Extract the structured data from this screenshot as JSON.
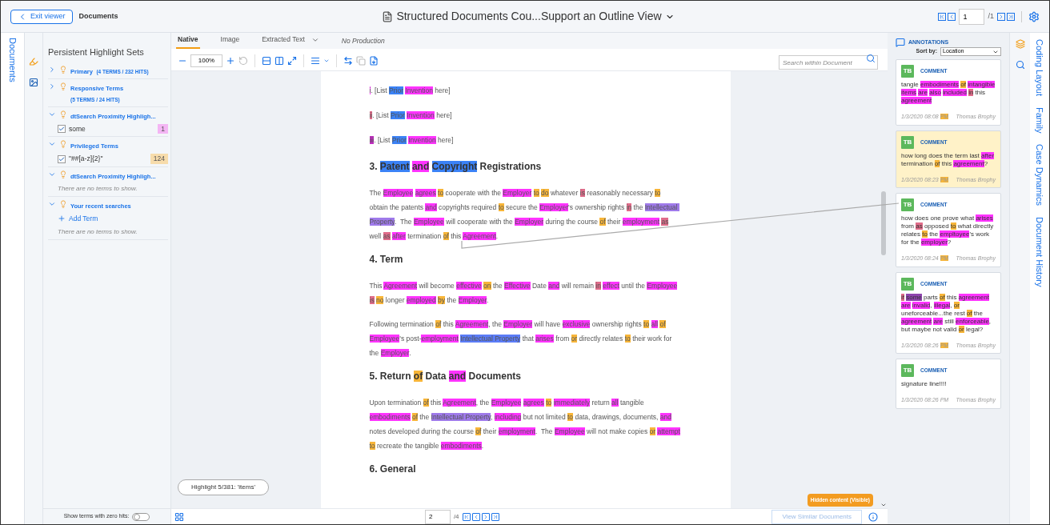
{
  "topbar": {
    "exit_button": "Exit viewer",
    "breadcrumb": "Documents",
    "title": "Structured Documents Cou...Support an Outline View",
    "page": "1",
    "page_total": "/1"
  },
  "left_rail": {
    "tab": "Documents"
  },
  "highlights": {
    "title": "Persistent Highlight Sets",
    "sets": [
      {
        "name": "Primary",
        "summary": "(4 TERMS / 232 HITS)",
        "expanded": false
      },
      {
        "name": "Responsive Terms",
        "summary": "(5 TERMS / 24 HITS)",
        "expanded": false
      },
      {
        "name": "dtSearch Proximity Highligh...",
        "expanded": true,
        "terms": [
          {
            "label": "some",
            "checked": true,
            "count": "1",
            "color": "#f4b6f4"
          }
        ]
      },
      {
        "name": "Privileged Terms",
        "expanded": true,
        "terms": [
          {
            "label": "\"##[a-z]{2}\"",
            "checked": true,
            "count": "124",
            "color": "#f7dcab"
          }
        ]
      },
      {
        "name": "dtSearch Proximity Highligh...",
        "expanded": true,
        "empty": "There are no terms to show."
      },
      {
        "name": "Your recent searches",
        "expanded": true,
        "add_term": "Add Term",
        "empty": "There are no terms to show."
      }
    ],
    "zero_hits_label": "Show terms with zero hits:",
    "zero_hits_on": false,
    "highlight_status": "Highlight 5/381: 'items'"
  },
  "viewer": {
    "tabs": [
      {
        "label": "Native",
        "kind": "tab",
        "selected": true
      },
      {
        "label": "Image",
        "kind": "tab",
        "selected": false
      },
      {
        "label": "Extracted Text",
        "kind": "dropdown",
        "selected": false
      }
    ],
    "production_status": "No Production",
    "zoom": "100%",
    "search_placeholder": "Search within Document",
    "document": [
      {
        "kind": "list_item",
        "segments": [
          {
            "text": "i",
            "color": "#ff33ff"
          },
          {
            "text": ". [List "
          },
          {
            "text": "Prior",
            "color": "#3b82f6"
          },
          {
            "text": " Invention",
            "color": "#ff33ff"
          },
          {
            "text": " here]"
          }
        ]
      },
      {
        "kind": "list_item",
        "segments": [
          {
            "text": "ii",
            "color": "#e06c8a"
          },
          {
            "text": ". [List "
          },
          {
            "text": "Prior",
            "color": "#3b82f6"
          },
          {
            "text": " Invention",
            "color": "#ff33ff"
          },
          {
            "text": " here]"
          }
        ]
      },
      {
        "kind": "list_item",
        "segments": [
          {
            "text": "iii",
            "color": "#c22cc2"
          },
          {
            "text": ". [List "
          },
          {
            "text": "Prior",
            "color": "#3b82f6"
          },
          {
            "text": " Invention",
            "color": "#ff33ff"
          },
          {
            "text": " here]"
          }
        ]
      },
      {
        "kind": "heading",
        "segments": [
          {
            "text": "3.  "
          },
          {
            "text": "Patent",
            "color": "#3b82f6"
          },
          {
            "text": " and",
            "color": "#ff33ff"
          },
          {
            "text": " Copyright",
            "color": "#3b82f6"
          },
          {
            "text": " Registrations"
          }
        ]
      },
      {
        "kind": "paragraph",
        "segments": [
          {
            "text": "The "
          },
          {
            "text": "Employee",
            "color": "#ff33ff"
          },
          {
            "text": " agrees",
            "color": "#ff33ff"
          },
          {
            "text": " to",
            "color": "#f7b538"
          },
          {
            "text": " cooperate with the "
          },
          {
            "text": "Employer",
            "color": "#ff33ff"
          },
          {
            "text": " to",
            "color": "#f7b538"
          },
          {
            "text": " do",
            "color": "#f7b538"
          },
          {
            "text": " whatever "
          },
          {
            "text": "is",
            "color": "#e06c8a"
          },
          {
            "text": " reasonably necessary "
          },
          {
            "text": "to",
            "color": "#f7b538"
          },
          {
            "text": " obtain the patents "
          },
          {
            "text": "and",
            "color": "#ff33ff"
          },
          {
            "text": " copyrights required "
          },
          {
            "text": "to",
            "color": "#f7b538"
          },
          {
            "text": " secure the "
          },
          {
            "text": "Employer",
            "color": "#ff33ff"
          },
          {
            "text": "'s ownership rights "
          },
          {
            "text": "in",
            "color": "#e06c8a"
          },
          {
            "text": " the "
          },
          {
            "text": "Intellectual Property",
            "color": "#9f7aea"
          },
          {
            "text": ".  The "
          },
          {
            "text": "Employee",
            "color": "#ff33ff"
          },
          {
            "text": " will cooperate with the "
          },
          {
            "text": "Employer",
            "color": "#ff33ff"
          },
          {
            "text": " during the course "
          },
          {
            "text": "of",
            "color": "#f7b538"
          },
          {
            "text": " their "
          },
          {
            "text": "employment",
            "color": "#ff33ff"
          },
          {
            "text": " as",
            "color": "#e06c8a"
          },
          {
            "text": " well "
          },
          {
            "text": "as",
            "color": "#e06c8a"
          },
          {
            "text": " after",
            "color": "#ff33ff"
          },
          {
            "text": " termination "
          },
          {
            "text": "of",
            "color": "#f7b538"
          },
          {
            "text": " this "
          },
          {
            "text": "Agreement",
            "color": "#ff33ff"
          },
          {
            "text": "."
          }
        ]
      },
      {
        "kind": "heading",
        "segments": [
          {
            "text": "4.  Term"
          }
        ]
      },
      {
        "kind": "paragraph",
        "segments": [
          {
            "text": "This "
          },
          {
            "text": "Agreement",
            "color": "#ff33ff"
          },
          {
            "text": " will become "
          },
          {
            "text": "effective",
            "color": "#ff33ff"
          },
          {
            "text": " on",
            "color": "#f7b538"
          },
          {
            "text": " the "
          },
          {
            "text": "Effective",
            "color": "#ff33ff"
          },
          {
            "text": " Date "
          },
          {
            "text": "and",
            "color": "#ff33ff"
          },
          {
            "text": " will remain "
          },
          {
            "text": "in",
            "color": "#e06c8a"
          },
          {
            "text": " effect",
            "color": "#ff33ff"
          },
          {
            "text": " until the "
          },
          {
            "text": "Employee",
            "color": "#ff33ff"
          },
          {
            "text": " is",
            "color": "#e06c8a"
          },
          {
            "text": " no",
            "color": "#f7b538"
          },
          {
            "text": " longer "
          },
          {
            "text": "employed",
            "color": "#ff33ff"
          },
          {
            "text": " by",
            "color": "#f7b538"
          },
          {
            "text": " the "
          },
          {
            "text": "Employer",
            "color": "#ff33ff"
          },
          {
            "text": "."
          }
        ]
      },
      {
        "kind": "paragraph",
        "segments": [
          {
            "text": "Following termination "
          },
          {
            "text": "of",
            "color": "#f7b538"
          },
          {
            "text": " this "
          },
          {
            "text": "Agreement",
            "color": "#ff33ff"
          },
          {
            "text": ", the "
          },
          {
            "text": "Employer",
            "color": "#ff33ff"
          },
          {
            "text": " will have "
          },
          {
            "text": "exclusive",
            "color": "#ff33ff"
          },
          {
            "text": " ownership rights "
          },
          {
            "text": "to",
            "color": "#f7b538"
          },
          {
            "text": " all",
            "color": "#ff33ff"
          },
          {
            "text": " of",
            "color": "#f7b538"
          },
          {
            "text": " Employee",
            "color": "#ff33ff"
          },
          {
            "text": "'s post-"
          },
          {
            "text": "employment",
            "color": "#ff33ff"
          },
          {
            "text": " Intellectual Property",
            "color": "#5b7cf7"
          },
          {
            "text": " that "
          },
          {
            "text": "arises",
            "color": "#ff33ff"
          },
          {
            "text": " from "
          },
          {
            "text": "or",
            "color": "#f7b538"
          },
          {
            "text": " directly relates "
          },
          {
            "text": "to",
            "color": "#f7b538"
          },
          {
            "text": " their work for the "
          },
          {
            "text": "Employer",
            "color": "#ff33ff"
          },
          {
            "text": "."
          }
        ]
      },
      {
        "kind": "heading",
        "segments": [
          {
            "text": "5.  Return "
          },
          {
            "text": "of",
            "color": "#f7b538"
          },
          {
            "text": " Data "
          },
          {
            "text": "and",
            "color": "#ff33ff"
          },
          {
            "text": " Documents"
          }
        ]
      },
      {
        "kind": "paragraph",
        "segments": [
          {
            "text": "Upon termination "
          },
          {
            "text": "of",
            "color": "#f7b538"
          },
          {
            "text": " this "
          },
          {
            "text": "Agreement",
            "color": "#ff33ff"
          },
          {
            "text": ", the "
          },
          {
            "text": "Employee",
            "color": "#ff33ff"
          },
          {
            "text": " agrees",
            "color": "#ff33ff"
          },
          {
            "text": " to",
            "color": "#f7b538"
          },
          {
            "text": " immediately",
            "color": "#ff33ff"
          },
          {
            "text": " return "
          },
          {
            "text": "all",
            "color": "#ff33ff"
          },
          {
            "text": " tangible "
          },
          {
            "text": "embodiments",
            "color": "#ff33ff"
          },
          {
            "text": " of",
            "color": "#f7b538"
          },
          {
            "text": " the "
          },
          {
            "text": "Intellectual Property",
            "color": "#9f7aea"
          },
          {
            "text": ", "
          },
          {
            "text": "including",
            "color": "#ff33ff"
          },
          {
            "text": " but not limited "
          },
          {
            "text": "to",
            "color": "#f7b538"
          },
          {
            "text": " data, drawings, documents, "
          },
          {
            "text": "and",
            "color": "#ff33ff"
          },
          {
            "text": " notes developed during the course "
          },
          {
            "text": "of",
            "color": "#f7b538"
          },
          {
            "text": " their "
          },
          {
            "text": "employment",
            "color": "#ff33ff"
          },
          {
            "text": ".  The "
          },
          {
            "text": "Employee",
            "color": "#ff33ff"
          },
          {
            "text": " will not make copies "
          },
          {
            "text": "or",
            "color": "#f7b538"
          },
          {
            "text": " attempt",
            "color": "#ff33ff"
          },
          {
            "text": " to",
            "color": "#f7b538"
          },
          {
            "text": " recreate the tangible "
          },
          {
            "text": "embodiments",
            "color": "#ff33ff"
          },
          {
            "text": "."
          }
        ]
      },
      {
        "kind": "heading",
        "segments": [
          {
            "text": "6.  General"
          }
        ]
      }
    ],
    "hidden_content": "Hidden content (Visible)",
    "page": "2",
    "page_total": "/4",
    "similar_button": "View Similar Documents"
  },
  "annotations": {
    "title": "ANNOTATIONS",
    "sort_label": "Sort by:",
    "sort_value": "Location",
    "items": [
      {
        "initials": "TB",
        "type": "COMMENT",
        "selected": false,
        "text": [
          {
            "text": "tangle "
          },
          {
            "text": "embodiments",
            "color": "#ff33ff"
          },
          {
            "text": " of",
            "color": "#f7b538"
          },
          {
            "text": " intangible",
            "color": "#ff33ff"
          },
          {
            "text": " items",
            "color": "#ff33ff"
          },
          {
            "text": " are",
            "color": "#ff33ff"
          },
          {
            "text": " also",
            "color": "#ff33ff"
          },
          {
            "text": " included",
            "color": "#ff33ff"
          },
          {
            "text": " in",
            "color": "#e06c8a"
          },
          {
            "text": " this "
          },
          {
            "text": "agreement",
            "color": "#ff33ff"
          }
        ],
        "date": [
          {
            "text": "1/3/2020 08:08 "
          },
          {
            "text": "PM",
            "color": "#f7b538"
          }
        ],
        "author": "Thomas Brophy"
      },
      {
        "initials": "TB",
        "type": "COMMENT",
        "selected": true,
        "text": [
          {
            "text": "how long does the term last "
          },
          {
            "text": "after",
            "color": "#ff33ff"
          },
          {
            "text": " termination "
          },
          {
            "text": "of",
            "color": "#f7b538"
          },
          {
            "text": " this "
          },
          {
            "text": "agreement",
            "color": "#ff33ff"
          },
          {
            "text": "?"
          }
        ],
        "date": [
          {
            "text": "1/3/2020 08:23 "
          },
          {
            "text": "PM",
            "color": "#f7b538"
          }
        ],
        "author": "Thomas Brophy"
      },
      {
        "initials": "TB",
        "type": "COMMENT",
        "selected": false,
        "text": [
          {
            "text": "how does one prove what "
          },
          {
            "text": "arises",
            "color": "#ff33ff"
          },
          {
            "text": " from "
          },
          {
            "text": "as",
            "color": "#e06c8a"
          },
          {
            "text": " opposed "
          },
          {
            "text": "to",
            "color": "#f7b538"
          },
          {
            "text": " what directly relates "
          },
          {
            "text": "to",
            "color": "#f7b538"
          },
          {
            "text": " the "
          },
          {
            "text": "empltoyee",
            "color": "#ff33ff"
          },
          {
            "text": "'s work for the "
          },
          {
            "text": "employer",
            "color": "#ff33ff"
          },
          {
            "text": "?"
          }
        ],
        "date": [
          {
            "text": "1/3/2020 08:24 "
          },
          {
            "text": "PM",
            "color": "#f7b538"
          }
        ],
        "author": "Thomas Brophy"
      },
      {
        "initials": "TB",
        "type": "COMMENT",
        "selected": false,
        "text": [
          {
            "text": "if",
            "color": "#e06c8a"
          },
          {
            "text": " some",
            "color": "#8e44ad"
          },
          {
            "text": " parts "
          },
          {
            "text": "of",
            "color": "#f7b538"
          },
          {
            "text": " this "
          },
          {
            "text": "agreement",
            "color": "#ff33ff"
          },
          {
            "text": " are",
            "color": "#ff33ff"
          },
          {
            "text": " invalid",
            "color": "#ff33ff"
          },
          {
            "text": ", "
          },
          {
            "text": "illegal",
            "color": "#ff33ff"
          },
          {
            "text": ", "
          },
          {
            "text": "or",
            "color": "#f7b538"
          },
          {
            "text": " uneforceable...the rest "
          },
          {
            "text": "of",
            "color": "#f7b538"
          },
          {
            "text": " the "
          },
          {
            "text": "agreement",
            "color": "#ff33ff"
          },
          {
            "text": " are",
            "color": "#ff33ff"
          },
          {
            "text": " still "
          },
          {
            "text": "enforceable",
            "color": "#ff33ff"
          },
          {
            "text": ", but maybe not valid "
          },
          {
            "text": "or",
            "color": "#f7b538"
          },
          {
            "text": " legal?"
          }
        ],
        "date": [
          {
            "text": "1/3/2020 08:26 "
          },
          {
            "text": "PM",
            "color": "#f7b538"
          }
        ],
        "author": "Thomas Brophy"
      },
      {
        "initials": "TB",
        "type": "COMMENT",
        "selected": false,
        "text": [
          {
            "text": "signature line!!!!"
          }
        ],
        "date": [
          {
            "text": "1/3/2020 08:26 PM"
          }
        ],
        "author": "Thomas Brophy"
      }
    ]
  },
  "right_rail": {
    "tabs": [
      "Coding Layout",
      "Family",
      "Case Dynamics",
      "Document History"
    ]
  }
}
